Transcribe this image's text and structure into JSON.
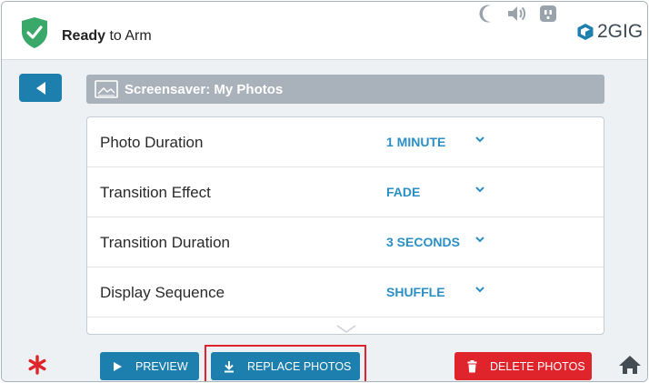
{
  "status": {
    "bold_word": "Ready",
    "rest": " to Arm",
    "shield_color": "#3aa869"
  },
  "top_icons": [
    "moon-icon",
    "speaker-icon",
    "outlet-icon"
  ],
  "brand": {
    "name": "2GIG"
  },
  "screen": {
    "title": "Screensaver: My Photos"
  },
  "settings": [
    {
      "label": "Photo Duration",
      "value": "1 MINUTE"
    },
    {
      "label": "Transition Effect",
      "value": "FADE"
    },
    {
      "label": "Transition Duration",
      "value": "3 SECONDS"
    },
    {
      "label": "Display Sequence",
      "value": "SHUFFLE"
    }
  ],
  "bottom": {
    "preview_label": "PREVIEW",
    "replace_label": "REPLACE PHOTOS",
    "delete_label": "DELETE PHOTOS"
  },
  "colors": {
    "accent": "#1c7fae",
    "value_text": "#2a8fc4",
    "danger": "#e0242b",
    "header_bar": "#a9b2ba",
    "toggle_on": "#7bbf4e"
  }
}
